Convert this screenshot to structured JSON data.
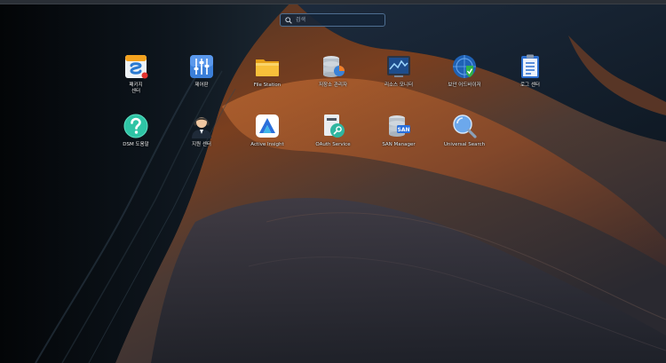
{
  "search": {
    "placeholder": "검색",
    "value": ""
  },
  "apps": [
    {
      "id": "package-center",
      "label": "패키지\n센터",
      "icon": "package-center-icon"
    },
    {
      "id": "control-panel",
      "label": "제어판",
      "icon": "control-panel-icon"
    },
    {
      "id": "file-station",
      "label": "File Station",
      "icon": "folder-icon"
    },
    {
      "id": "storage-manager",
      "label": "저장소 관리자",
      "icon": "storage-manager-icon"
    },
    {
      "id": "resource-monitor",
      "label": "리소스 모니터",
      "icon": "resource-monitor-icon"
    },
    {
      "id": "security-advisor",
      "label": "보안 어드바이저",
      "icon": "security-advisor-icon"
    },
    {
      "id": "log-center",
      "label": "로그 센터",
      "icon": "log-center-icon"
    },
    {
      "id": "dsm-help",
      "label": "DSM 도움말",
      "icon": "help-icon"
    },
    {
      "id": "support-center",
      "label": "지원 센터",
      "icon": "support-agent-icon"
    },
    {
      "id": "active-insight",
      "label": "Active Insight",
      "icon": "active-insight-icon"
    },
    {
      "id": "oauth-service",
      "label": "OAuth Service",
      "icon": "oauth-service-icon"
    },
    {
      "id": "san-manager",
      "label": "SAN Manager",
      "icon": "san-manager-icon"
    },
    {
      "id": "universal-search",
      "label": "Universal Search",
      "icon": "universal-search-icon"
    }
  ]
}
